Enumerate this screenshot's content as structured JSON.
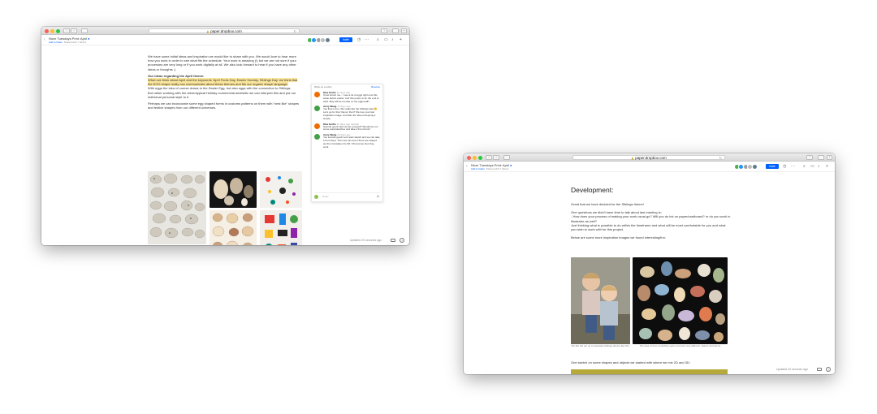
{
  "windows": [
    {
      "url": "paper.dropbox.com",
      "doc_title": "Nicer Tuesdays Print: April",
      "add_to_folder": "Add to folder",
      "shared": "Shared with 7 others",
      "invite": "Invite",
      "paragraphs": {
        "p1": "We have some initial ideas and inspiration we would like to share with you. We would love to hear more how you work in order to see what fits the schedule. Your work is amazing (!) but we are not sure if your processes are very long or if you work digitally at all. We also look forward to hear if you have any other ideas or thoughts :)",
        "heading": "Our ideas regarding the April theme:",
        "hl1": "When we think about April and the keywords 'April Fools Day, Easter Sunday, Siblings Day' we think that the EGG shape really can communicate about these themes and fits our organic shape language.",
        "p2": "With eggs the idea of course draws to the Easter Egg, but also eggs with the connection to Siblings.",
        "p3": "But rather working with the stereotypical Holiday commercial aesthetic we can interpret this and put our individual personal style to it.",
        "p4": "Perhaps we can incorporate some egg shaped forms in customs patterns on them with \"nest like\" shapes and festive shapes from our different universes."
      },
      "comments": {
        "header": "Work on a robot",
        "resolve": "Resolve",
        "items": [
          {
            "name": "Klas Ernflo",
            "time": "10 days ago",
            "text": "It just struck me... I see a lot of eggs right now this week before easter. And this poster is for the end of April. May will be too late on the eggs ball?"
          },
          {
            "name": "Anny Wang",
            "time": "10 days ago",
            "text": "Yes that is true. We really like the Siblings idea 😊. Let's go for that 'theme' then? We love your last inspiration image. And also the idea of keeping it simple."
          },
          {
            "name": "Klas Ernflo",
            "time": "10 days ago (edited)",
            "text": "Sounds good! How do we proceed? Should we run some tests/sketches and take it from there?"
          },
          {
            "name": "Anny Wang",
            "time": "10 days ago",
            "text": "Yes sounds good! Let's start sketch and we can take it from there. Then we can see if there are shapes we then translate into 2D / 3D and we how they work"
          }
        ],
        "reply": "Reply"
      },
      "footer": "Updated 20 seconds ago"
    },
    {
      "url": "paper.dropbox.com",
      "doc_title": "Nicer Tuesdays Print: April",
      "add_to_folder": "Add to folder",
      "shared": "Shared with 7 others",
      "invite": "Invite",
      "heading": "Development:",
      "paragraphs": {
        "p1": "Great that we have decided for the Siblings theme!",
        "p2": "One questions we didn't have time to talk about last meeting is:",
        "p3": "- How does your process of making your work usual go? Will you do ink on paper/cardboard? or do you work in Illustrator as well?",
        "p4": "Just thinking what is possible to do within the timeframe and what will be most comfortable for you and what you wish to work with for this project.",
        "p5": "Below are some more inspiration images we found interesting/fun:",
        "cap1": "We like the set up to awkward siblings photos like this.",
        "cap2": "The idea of how something same can look very different. (Sand zoomed in)",
        "p6": "One sketch on some shapes and objects we started with where we mix 2D and 3D:"
      },
      "footer": "Updated 20 seconds ago"
    }
  ],
  "colors": {
    "accent": "#0061fe",
    "highlight": "#fbe59b",
    "sketch": "#b5a93a"
  }
}
